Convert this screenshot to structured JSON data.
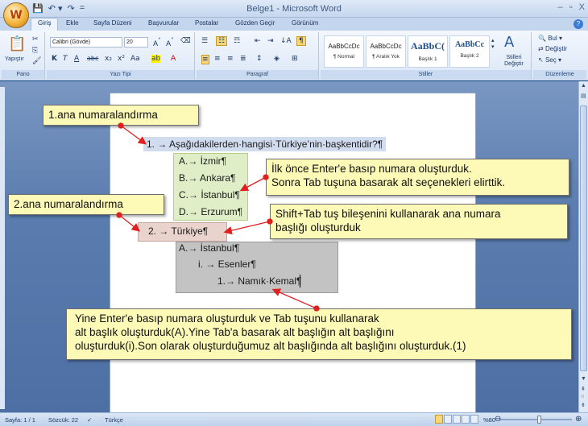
{
  "window": {
    "title": "Belge1 - Microsoft Word",
    "office_button": "W",
    "controls": [
      "–",
      "▫",
      "X"
    ]
  },
  "qat": {
    "save": "💾",
    "undo": "↶ ▾",
    "redo": "↷",
    "customize": "="
  },
  "tabs": [
    {
      "label": "Giriş",
      "active": true
    },
    {
      "label": "Ekle"
    },
    {
      "label": "Sayfa Düzeni"
    },
    {
      "label": "Başvurular"
    },
    {
      "label": "Postalar"
    },
    {
      "label": "Gözden Geçir"
    },
    {
      "label": "Görünüm"
    }
  ],
  "ribbon": {
    "pano": {
      "label": "Pano",
      "paste": "Yapıştır"
    },
    "font": {
      "label": "Yazı Tipi",
      "name": "Calibri (Gövde)",
      "size": "20"
    },
    "paragraph": {
      "label": "Paragraf"
    },
    "styles": {
      "label": "Stiller",
      "items": [
        {
          "sample": "AaBbCcDc",
          "name": "¶ Normal"
        },
        {
          "sample": "AaBbCcDc",
          "name": "¶ Aralık Yok"
        },
        {
          "sample": "AaBbC(",
          "name": "Başlık 1"
        },
        {
          "sample": "AaBbCc",
          "name": "Başlık 2"
        }
      ],
      "change": "Stilleri Değiştir"
    },
    "editing": {
      "label": "Düzenleme",
      "find": "Bul",
      "replace": "Değiştir",
      "select": "Seç"
    }
  },
  "document": {
    "lines": [
      {
        "text": "1. → Aşağıdakilerden·hangisi·Türkiye’nin·başkentidir?¶"
      },
      {
        "text": "A.→ İzmir¶"
      },
      {
        "text": "B.→ Ankara¶"
      },
      {
        "text": "C.→ İstanbul¶"
      },
      {
        "text": "D.→ Erzurum¶"
      },
      {
        "text": "2. → Türkiye¶"
      },
      {
        "text": "A.→ İstanbul¶"
      },
      {
        "text": "i. → Esenler¶"
      },
      {
        "text": "1.→ Namık·Kemal¶"
      }
    ]
  },
  "callouts": {
    "c1": "1.ana numaralandırma",
    "c2": "2.ana numaralandırma",
    "c3_line1": "İlk önce Enter'e basıp numara oluşturduk.",
    "c3_line2": "Sonra Tab tuşuna basarak alt seçenekleri elirttik.",
    "c4_line1": "Shift+Tab tuş bileşenini kullanarak ana numara",
    "c4_line2": "başlığı oluşturduk",
    "c5_line1": "Yine Enter'e basıp numara oluşturduk ve Tab tuşunu kullanarak",
    "c5_line2": "alt başlık oluşturduk(A).Yine Tab'a basarak alt başlığın alt başlığını",
    "c5_line3": "oluşturduk(i).Son olarak oluşturduğumuz alt başlığında alt başlığını oluşturduk.(1)"
  },
  "colors": {
    "callout_bg": "#fdf9b7",
    "arrow": "#e02020",
    "accent": "#2c5a94"
  },
  "status": {
    "page": "Sayfa: 1 / 1",
    "words": "Sözcük: 22",
    "language": "Türkçe",
    "zoom": "%80"
  }
}
